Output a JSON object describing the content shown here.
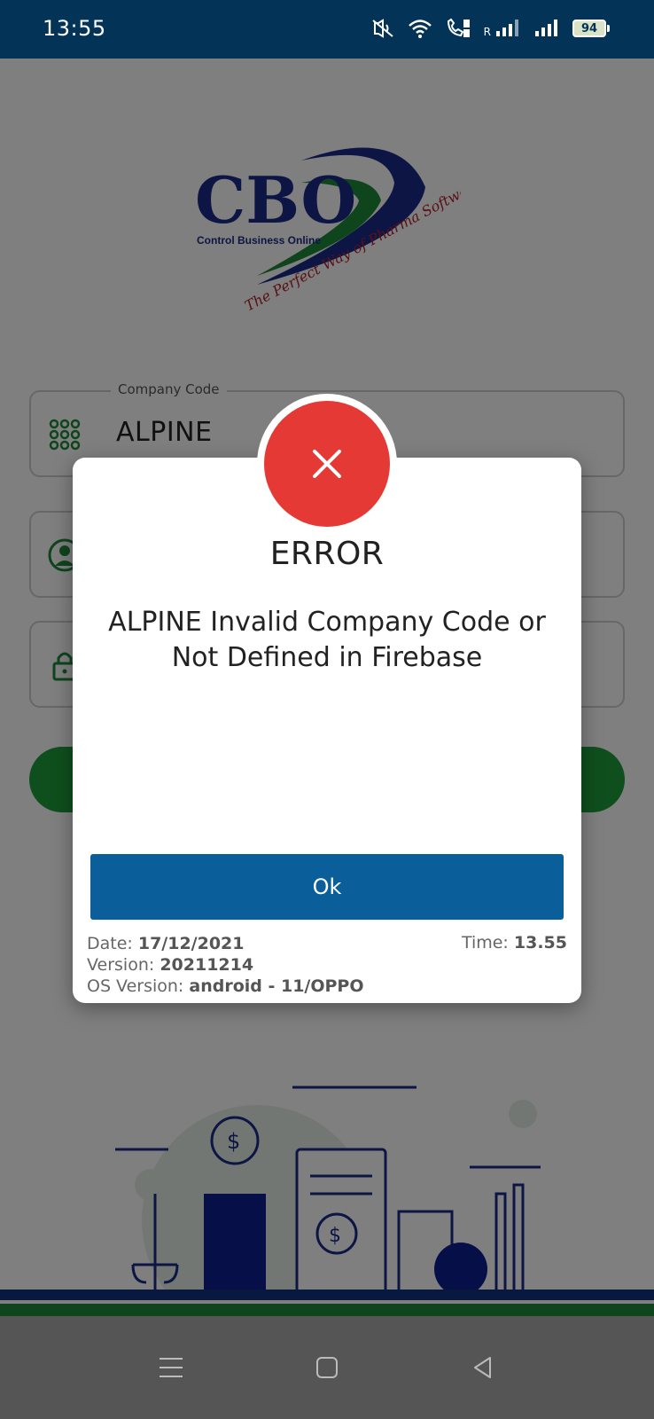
{
  "status_bar": {
    "time": "13:55",
    "battery_level": "94",
    "signal_label": "R",
    "icons": [
      "mute-icon",
      "wifi-icon",
      "wifi-calling-icon",
      "signal-1-icon",
      "signal-2-icon",
      "battery-icon"
    ]
  },
  "logo": {
    "brand": "CBO",
    "subtitle": "Control Business Online",
    "tagline": "The Perfect Way of Pharma Software"
  },
  "form": {
    "company_code_label": "Company Code",
    "company_code_value": "ALPINE",
    "icons": [
      "grid-icon",
      "user-icon",
      "lock-icon"
    ]
  },
  "dialog": {
    "title": "ERROR",
    "message": "ALPINE Invalid Company Code or Not Defined in Firebase",
    "ok_label": "Ok",
    "date_label": "Date: ",
    "date_value": "17/12/2021",
    "time_label": "Time: ",
    "time_value": "13.55",
    "version_label": "Version: ",
    "version_value": "20211214",
    "os_label": "OS Version: ",
    "os_value": "android - 11/OPPO",
    "icon": "close-icon",
    "icon_color": "#e53935"
  },
  "colors": {
    "status_bar": "#033458",
    "primary_button": "#0a5e99",
    "login_button": "#1e9e3a",
    "brand_blue": "#1b2a8a",
    "brand_green": "#1f8a3b",
    "brand_red": "#b3202a"
  },
  "nav_bar": {
    "buttons": [
      "menu-icon",
      "home-icon",
      "back-icon"
    ]
  }
}
